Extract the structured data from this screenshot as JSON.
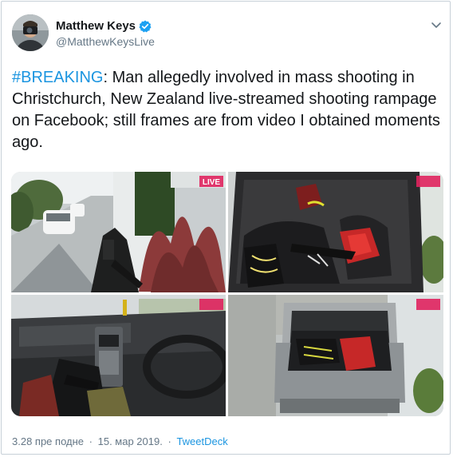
{
  "user": {
    "name": "Matthew Keys",
    "handle": "@MatthewKeysLive"
  },
  "tweet": {
    "hashtag": "#BREAKING",
    "text": ": Man allegedly involved in mass shooting in Christchurch, New Zealand live-streamed shooting rampage on Facebook; still frames are from video I obtained moments ago."
  },
  "media": {
    "overlay_label": "LIVE"
  },
  "footer": {
    "time": "3.28 пре подне",
    "separator": "·",
    "date": "15. мар 2019.",
    "source": "TweetDeck"
  },
  "colors": {
    "link": "#1b95e0",
    "text": "#14171a",
    "muted": "#657786",
    "live_badge": "#e0245e"
  },
  "icons": [
    "verified-badge-icon",
    "chevron-down-icon"
  ]
}
